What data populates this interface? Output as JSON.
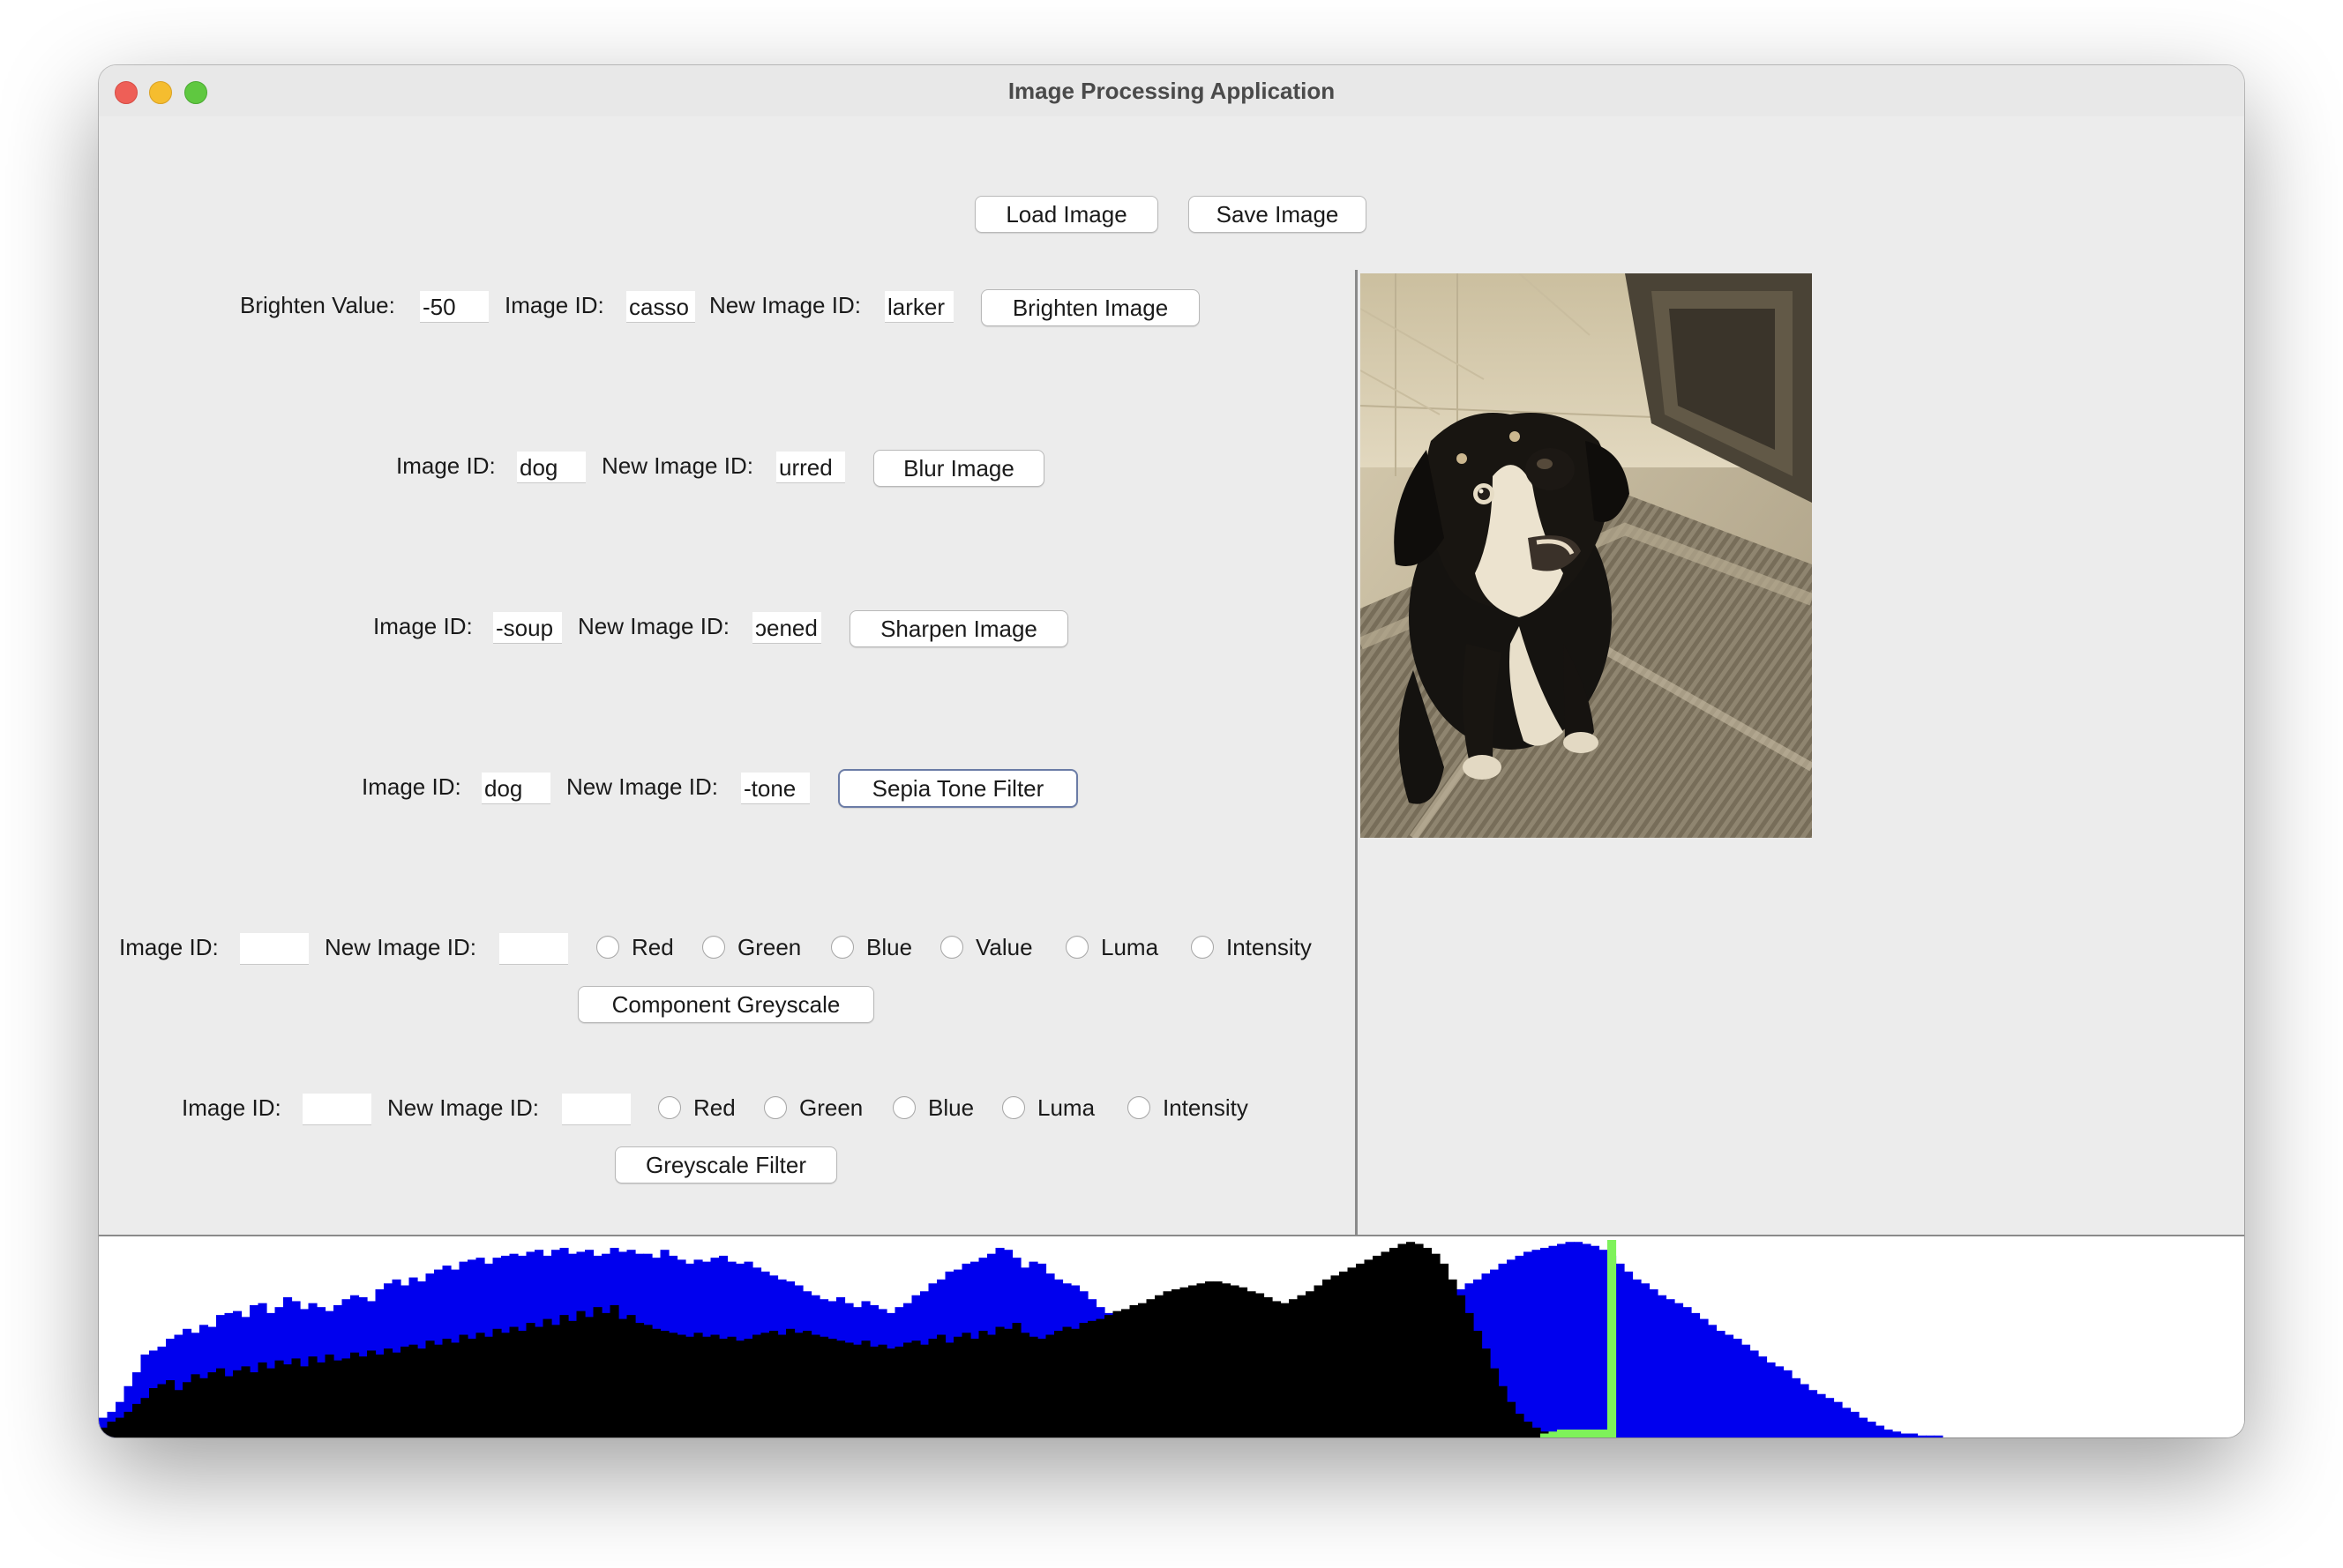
{
  "window": {
    "title": "Image Processing Application"
  },
  "toolbar": {
    "load_label": "Load Image",
    "save_label": "Save Image"
  },
  "brighten": {
    "value_label": "Brighten Value:",
    "value": "-50",
    "image_id_label": "Image ID:",
    "image_id": "casso",
    "new_id_label": "New Image ID:",
    "new_id": "larker",
    "button": "Brighten Image"
  },
  "blur": {
    "image_id_label": "Image ID:",
    "image_id": "dog",
    "new_id_label": "New Image ID:",
    "new_id": "urred",
    "button": "Blur Image"
  },
  "sharpen": {
    "image_id_label": "Image ID:",
    "image_id": "-soup",
    "new_id_label": "New Image ID:",
    "new_id": "ɔened",
    "button": "Sharpen Image"
  },
  "sepia": {
    "image_id_label": "Image ID:",
    "image_id": "dog",
    "new_id_label": "New Image ID:",
    "new_id": "-tone",
    "button": "Sepia Tone Filter"
  },
  "component": {
    "image_id_label": "Image ID:",
    "image_id": "",
    "new_id_label": "New Image ID:",
    "new_id": "",
    "options": [
      "Red",
      "Green",
      "Blue",
      "Value",
      "Luma",
      "Intensity"
    ],
    "button": "Component Greyscale"
  },
  "greyscale": {
    "image_id_label": "Image ID:",
    "image_id": "",
    "new_id_label": "New Image ID:",
    "new_id": "",
    "options": [
      "Red",
      "Green",
      "Blue",
      "Luma",
      "Intensity"
    ],
    "button": "Greyscale Filter"
  },
  "preview": {
    "alt": "Sepia-toned photo of a puppy"
  },
  "colors": {
    "blue_series": "#0000ee",
    "black_series": "#000000",
    "green_series": "#7ef25a"
  },
  "chart_data": {
    "type": "area",
    "title": "",
    "x_range": [
      0,
      255
    ],
    "y_range": [
      0,
      100
    ],
    "series": [
      {
        "color": "#0000ee",
        "values": [
          10,
          13,
          18,
          26,
          33,
          42,
          44,
          46,
          50,
          52,
          55,
          53,
          57,
          56,
          62,
          63,
          64,
          61,
          67,
          68,
          63,
          66,
          71,
          69,
          65,
          68,
          66,
          64,
          67,
          70,
          72,
          71,
          69,
          75,
          78,
          80,
          77,
          81,
          79,
          83,
          85,
          87,
          85,
          89,
          90,
          91,
          88,
          91,
          92,
          93,
          92,
          94,
          95,
          92,
          95,
          96,
          93,
          94,
          95,
          92,
          93,
          96,
          94,
          95,
          93,
          93,
          91,
          95,
          92,
          90,
          88,
          90,
          89,
          91,
          92,
          89,
          88,
          89,
          86,
          84,
          82,
          80,
          79,
          77,
          74,
          72,
          70,
          69,
          71,
          68,
          66,
          69,
          67,
          65,
          63,
          66,
          68,
          72,
          74,
          78,
          80,
          84,
          85,
          88,
          89,
          91,
          93,
          96,
          95,
          91,
          86,
          89,
          88,
          83,
          80,
          78,
          77,
          74,
          70,
          66,
          63,
          59,
          55,
          52,
          48,
          45,
          45,
          44,
          42,
          40,
          44,
          47,
          45,
          43,
          42,
          44,
          46,
          41,
          40,
          46,
          44,
          43,
          44,
          47,
          48,
          49,
          50,
          51,
          52,
          53,
          54,
          55,
          57,
          59,
          61,
          62,
          64,
          66,
          68,
          70,
          72,
          74,
          75,
          78,
          80,
          83,
          85,
          88,
          90,
          92,
          94,
          95,
          96,
          97,
          98,
          99,
          99,
          98,
          97,
          95,
          92,
          88,
          84,
          80,
          78,
          75,
          72,
          70,
          68,
          66,
          63,
          60,
          57,
          54,
          52,
          50,
          47,
          44,
          41,
          38,
          36,
          34,
          30,
          27,
          24,
          22,
          20,
          18,
          15,
          13,
          10,
          8,
          6,
          4,
          3,
          2,
          2,
          1,
          1,
          1,
          0,
          0,
          0,
          0,
          0,
          0,
          0,
          0,
          0,
          0,
          0,
          0,
          0,
          0,
          0,
          0,
          0,
          0,
          0,
          0,
          0,
          0,
          0,
          0,
          0,
          0,
          0,
          0,
          0,
          0,
          0,
          0,
          0,
          0,
          0,
          0,
          0,
          0,
          0,
          0,
          0,
          0,
          0,
          0
        ]
      },
      {
        "color": "#000000",
        "values": [
          5,
          8,
          10,
          13,
          17,
          20,
          25,
          27,
          29,
          24,
          28,
          32,
          30,
          33,
          35,
          31,
          34,
          36,
          33,
          38,
          35,
          39,
          37,
          40,
          36,
          41,
          38,
          42,
          39,
          40,
          43,
          41,
          44,
          42,
          45,
          43,
          46,
          47,
          45,
          49,
          47,
          50,
          48,
          52,
          50,
          53,
          51,
          55,
          53,
          56,
          54,
          58,
          56,
          60,
          57,
          62,
          59,
          64,
          61,
          66,
          63,
          67,
          60,
          62,
          58,
          57,
          55,
          54,
          53,
          52,
          51,
          53,
          51,
          52,
          50,
          51,
          49,
          50,
          52,
          53,
          54,
          52,
          55,
          53,
          54,
          52,
          51,
          50,
          49,
          48,
          47,
          49,
          46,
          47,
          45,
          46,
          48,
          49,
          47,
          50,
          52,
          48,
          51,
          53,
          50,
          54,
          52,
          56,
          55,
          58,
          53,
          51,
          50,
          52,
          54,
          56,
          55,
          58,
          59,
          60,
          62,
          64,
          65,
          67,
          68,
          70,
          72,
          74,
          75,
          76,
          77,
          78,
          79,
          79,
          78,
          77,
          76,
          74,
          73,
          71,
          69,
          68,
          70,
          72,
          74,
          77,
          80,
          82,
          84,
          86,
          88,
          90,
          92,
          94,
          96,
          98,
          99,
          98,
          96,
          93,
          88,
          80,
          72,
          63,
          54,
          45,
          35,
          26,
          18,
          12,
          8,
          5,
          3,
          2,
          1,
          1,
          1,
          0,
          0,
          0,
          0,
          0,
          0,
          0,
          0,
          0,
          0,
          0,
          0,
          0,
          0,
          0,
          0,
          0,
          0,
          0,
          0,
          0,
          0,
          0,
          0,
          0,
          0,
          0,
          0,
          0,
          0,
          0,
          0,
          0,
          0,
          0,
          0,
          0,
          0,
          0,
          0,
          0,
          0,
          0,
          0,
          0,
          0,
          0,
          0,
          0,
          0,
          0,
          0,
          0,
          0,
          0,
          0,
          0,
          0,
          0,
          0,
          0,
          0,
          0,
          0,
          0,
          0,
          0,
          0,
          0,
          0,
          0,
          0,
          0,
          0,
          0,
          0,
          0,
          0,
          0,
          0,
          0,
          0,
          0,
          0
        ]
      },
      {
        "color": "#7ef25a",
        "values": [
          0,
          0,
          0,
          0,
          0,
          0,
          0,
          0,
          0,
          0,
          0,
          0,
          0,
          0,
          0,
          0,
          0,
          0,
          0,
          0,
          0,
          0,
          0,
          0,
          0,
          0,
          0,
          0,
          0,
          0,
          0,
          0,
          0,
          0,
          0,
          0,
          0,
          0,
          0,
          0,
          0,
          0,
          0,
          0,
          0,
          0,
          0,
          0,
          0,
          0,
          0,
          0,
          0,
          0,
          0,
          0,
          0,
          0,
          0,
          0,
          0,
          0,
          0,
          0,
          0,
          0,
          0,
          0,
          0,
          0,
          0,
          0,
          0,
          0,
          0,
          0,
          0,
          0,
          0,
          0,
          0,
          0,
          0,
          0,
          0,
          0,
          0,
          0,
          0,
          0,
          0,
          0,
          0,
          0,
          0,
          0,
          0,
          0,
          0,
          0,
          0,
          0,
          0,
          0,
          0,
          0,
          0,
          0,
          0,
          0,
          0,
          0,
          0,
          0,
          0,
          0,
          0,
          0,
          0,
          0,
          0,
          0,
          0,
          0,
          0,
          0,
          0,
          0,
          0,
          0,
          0,
          0,
          0,
          0,
          0,
          0,
          0,
          0,
          0,
          0,
          0,
          0,
          0,
          0,
          0,
          0,
          0,
          0,
          0,
          0,
          0,
          0,
          0,
          0,
          0,
          0,
          0,
          0,
          0,
          0,
          0,
          0,
          0,
          0,
          0,
          0,
          0,
          0,
          0,
          0,
          0,
          0,
          2,
          3,
          4,
          4,
          4,
          4,
          4,
          4,
          100,
          0,
          0,
          0,
          0,
          0,
          0,
          0,
          0,
          0,
          0,
          0,
          0,
          0,
          0,
          0,
          0,
          0,
          0,
          0,
          0,
          0,
          0,
          0,
          0,
          0,
          0,
          0,
          0,
          0,
          0,
          0,
          0,
          0,
          0,
          0,
          0,
          0,
          0,
          0,
          0,
          0,
          0,
          0,
          0,
          0,
          0,
          0,
          0,
          0,
          0,
          0,
          0,
          0,
          0,
          0,
          0,
          0,
          0,
          0,
          0,
          0,
          0,
          0,
          0,
          0,
          0,
          0,
          0,
          0,
          0,
          0,
          0,
          0,
          0,
          0,
          0,
          0,
          0
        ]
      }
    ]
  }
}
